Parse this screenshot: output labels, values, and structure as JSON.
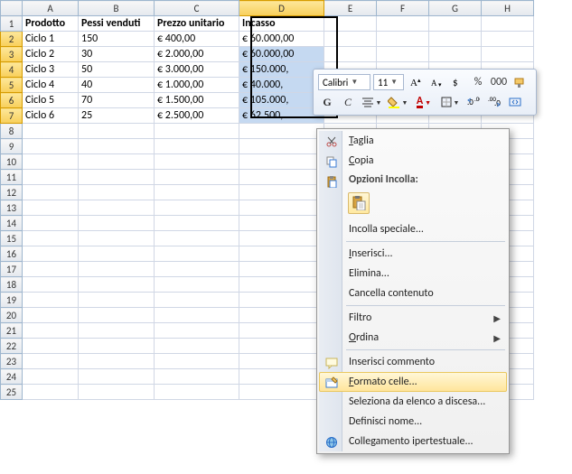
{
  "columns": [
    "A",
    "B",
    "C",
    "D",
    "E",
    "F",
    "G",
    "H"
  ],
  "headers": {
    "A": "Prodotto",
    "B": "Pessi venduti",
    "C": "Prezzo unitario",
    "D": "Incasso"
  },
  "rows": [
    {
      "A": "Ciclo 1",
      "B": "150",
      "C": "€ 400,00",
      "D": "€   60.000,00"
    },
    {
      "A": "Ciclo 2",
      "B": "30",
      "C": "€ 2.000,00",
      "D": "€   60.000,00"
    },
    {
      "A": "Ciclo 3",
      "B": "50",
      "C": "€ 3.000,00",
      "D": "€ 150.000,"
    },
    {
      "A": "Ciclo 4",
      "B": "40",
      "C": "€ 1.000,00",
      "D": "€   40.000,"
    },
    {
      "A": "Ciclo 5",
      "B": "70",
      "C": "€ 1.500,00",
      "D": "€ 105.000,"
    },
    {
      "A": "Ciclo 6",
      "B": "25",
      "C": "€ 2.500,00",
      "D": "€   62.500,"
    }
  ],
  "totalRows": 25,
  "miniToolbar": {
    "font": "Calibri",
    "size": "11",
    "bold": "G",
    "italic": "C",
    "percent": "%",
    "thousands": "000"
  },
  "contextMenu": {
    "cut": "Taglia",
    "copy": "Copia",
    "pasteOptionsLabel": "Opzioni Incolla:",
    "pasteSpecial": "Incolla speciale...",
    "insert": "Inserisci...",
    "delete": "Elimina...",
    "clear": "Cancella contenuto",
    "filter": "Filtro",
    "sort": "Ordina",
    "insertComment": "Inserisci commento",
    "formatCells": "Formato celle...",
    "pickList": "Seleziona da elenco a discesa...",
    "defineName": "Definisci nome...",
    "hyperlink": "Collegamento ipertestuale..."
  }
}
